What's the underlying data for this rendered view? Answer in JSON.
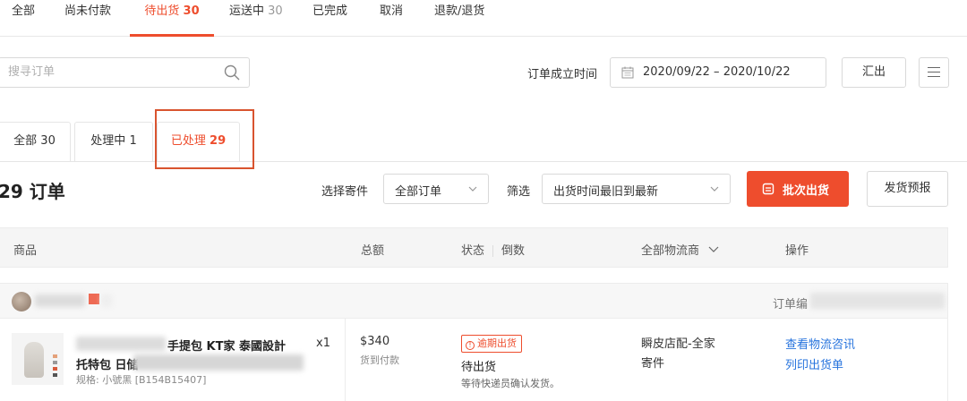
{
  "top_tabs": [
    {
      "label": "全部",
      "count": ""
    },
    {
      "label": "尚未付款",
      "count": ""
    },
    {
      "label": "待出货",
      "count": "30"
    },
    {
      "label": "运送中",
      "count": "30"
    },
    {
      "label": "已完成",
      "count": ""
    },
    {
      "label": "取消",
      "count": ""
    },
    {
      "label": "退款/退货",
      "count": ""
    }
  ],
  "search": {
    "placeholder": "搜寻订单"
  },
  "date_filter": {
    "label": "订单成立时间",
    "value": "2020/09/22 – 2020/10/22"
  },
  "export_label": "汇出",
  "sub_tabs": [
    {
      "label": "全部",
      "count": "30"
    },
    {
      "label": "处理中",
      "count": "1"
    },
    {
      "label": "已处理",
      "count": "29"
    }
  ],
  "toolbar": {
    "order_count": "29 订单",
    "shipping_label": "选择寄件",
    "shipping_value": "全部订单",
    "filter_label": "筛选",
    "filter_value": "出货时间最旧到最新",
    "batch_ship": "批次出货",
    "ship_preview": "发货预报"
  },
  "table_header": {
    "product": "商品",
    "total": "总额",
    "status": "状态",
    "countdown": "倒数",
    "carrier": "全部物流商",
    "action": "操作"
  },
  "order": {
    "order_no_label": "订单编",
    "product_title_a": "手提包 KT家 泰國設計",
    "quantity": "x1",
    "product_title_b": "托特包 日储",
    "spec": "规格: 小號黑 [B154B15407]",
    "price": "$340",
    "payment": "货到付款",
    "overdue_badge": "逾期出货",
    "status": "待出货",
    "status_note": "等待快递员确认发货。",
    "logistics_line1": "瞬皮店配-全家",
    "logistics_line2": "寄件",
    "actions": [
      "查看物流咨讯",
      "列印出货单"
    ]
  },
  "colors": {
    "accent": "#ee4d2d",
    "link": "#2673dd",
    "highlight": "#d9542f"
  }
}
